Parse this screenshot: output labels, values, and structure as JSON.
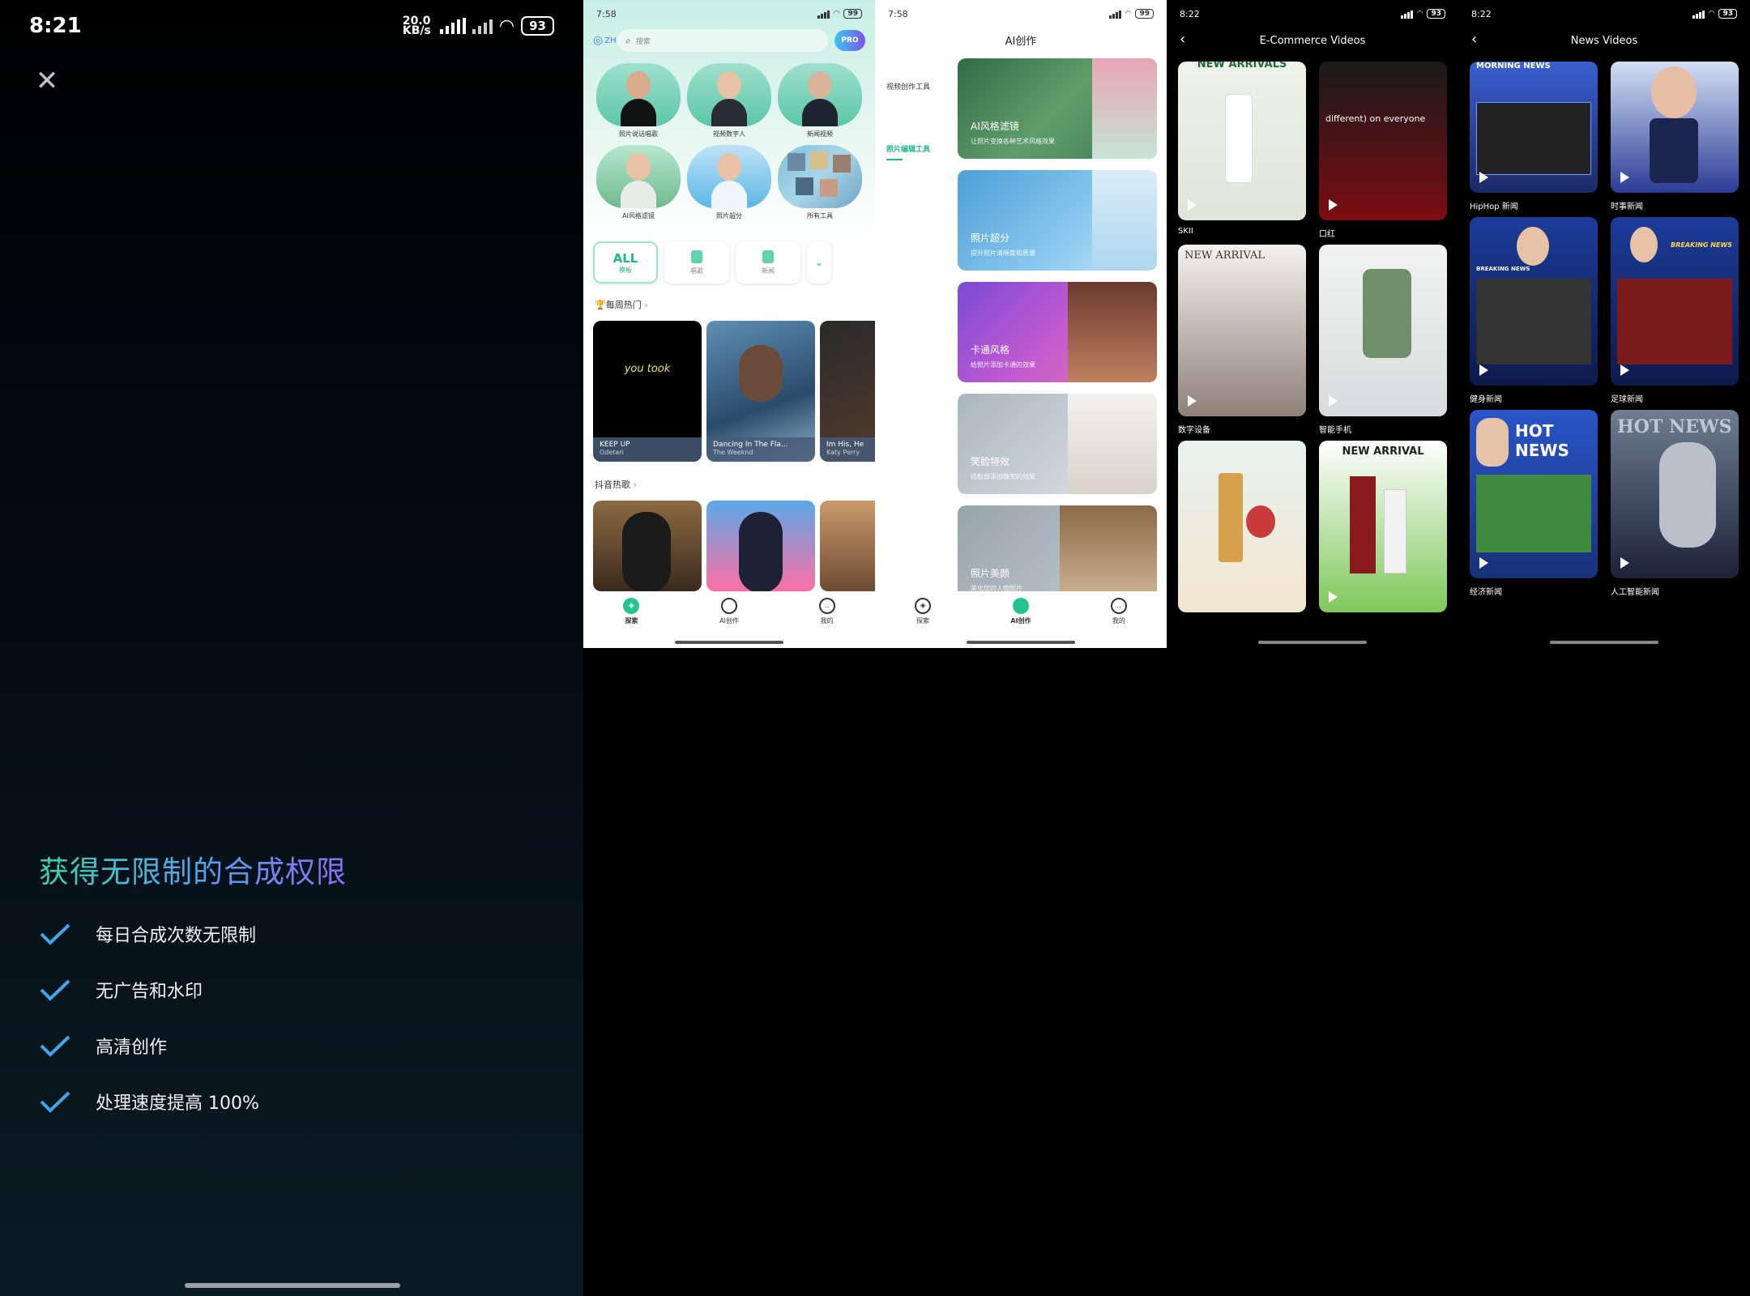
{
  "panel1": {
    "status": {
      "time": "8:21",
      "speed": "20.0 KB/s",
      "hd": "HD",
      "battery": "93"
    },
    "title": "获得无限制的合成权限",
    "features": [
      "每日合成次数无限制",
      "无广告和水印",
      "高清创作",
      "处理速度提高 100%"
    ]
  },
  "panel2": {
    "status": {
      "time": "7:58",
      "battery": "99"
    },
    "lang": "ZH",
    "search_placeholder": "搜索",
    "pro": "PRO",
    "tools": [
      "照片说话唱歌",
      "视频数字人",
      "新闻视频",
      "AI风格滤镜",
      "照片超分",
      "所有工具"
    ],
    "chips": [
      {
        "big": "ALL",
        "small": "模板"
      },
      {
        "small": "唱歌"
      },
      {
        "small": "新闻"
      }
    ],
    "section_weekly": "🏆每周热门",
    "weekly": [
      {
        "title": "KEEP UP",
        "artist": "Odetari",
        "overlay": "you took"
      },
      {
        "title": "Dancing In The Fla...",
        "artist": "The Weeknd"
      },
      {
        "title": "Im His, He",
        "artist": "Katy Perry"
      }
    ],
    "section_douyin": "抖音热歌",
    "nav": [
      "探索",
      "AI创作",
      "我的"
    ]
  },
  "panel3": {
    "status": {
      "time": "7:58",
      "battery": "99"
    },
    "title": "AI创作",
    "side": [
      "视频创作工具",
      "照片编辑工具"
    ],
    "features": [
      {
        "title": "AI风格滤镜",
        "desc": "让照片变换各种艺术风格效果"
      },
      {
        "title": "照片超分",
        "desc": "提升照片清晰度和质量"
      },
      {
        "title": "卡通风格",
        "desc": "给照片添加卡通的效果"
      },
      {
        "title": "笑脸特效",
        "desc": "给脸部添加微笑的效果"
      },
      {
        "title": "照片美颜",
        "desc": "美化您的人物照片"
      }
    ],
    "nav": [
      "探索",
      "AI创作",
      "我的"
    ]
  },
  "panel4": {
    "status": {
      "time": "8:22",
      "battery": "93"
    },
    "title": "E-Commerce Videos",
    "items": [
      {
        "label": "SKII",
        "overlay": "NEW ARRIVALS"
      },
      {
        "label": "口红",
        "overlay": "different) on everyone"
      },
      {
        "label": "数字设备",
        "overlay": "NEW ARRIVAL"
      },
      {
        "label": "智能手机",
        "overlay": ""
      },
      {
        "label": "",
        "overlay": ""
      },
      {
        "label": "",
        "overlay": "NEW ARRIVAL"
      }
    ]
  },
  "panel5": {
    "status": {
      "time": "8:22",
      "battery": "93"
    },
    "title": "News Videos",
    "items": [
      {
        "label": "HipHop 新闻",
        "overlay": "MORNING NEWS"
      },
      {
        "label": "时事新闻",
        "overlay": ""
      },
      {
        "label": "健身新闻",
        "overlay": "BREAKING NEWS"
      },
      {
        "label": "足球新闻",
        "overlay": "BREAKING NEWS"
      },
      {
        "label": "经济新闻",
        "overlay": "HOT NEWS"
      },
      {
        "label": "人工智能新闻",
        "overlay": "HOT NEWS"
      }
    ]
  }
}
